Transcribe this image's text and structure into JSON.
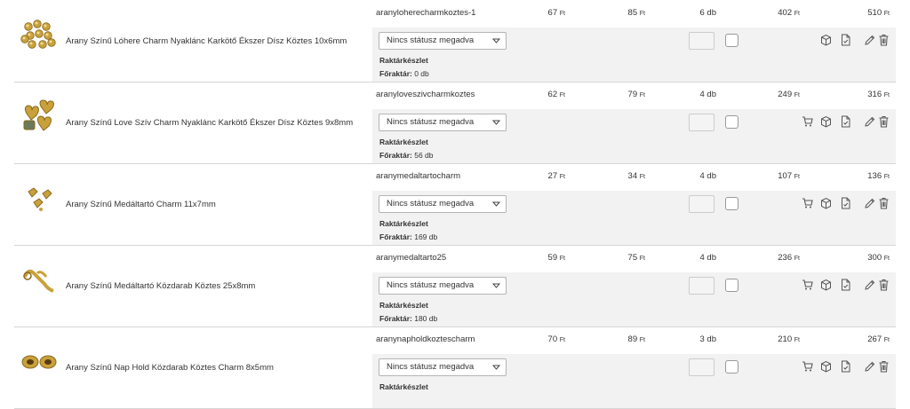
{
  "products": [
    {
      "name": "Arany Színű Lóhere Charm Nyaklánc Karkötő Ékszer Dísz Köztes 10x6mm",
      "sku": "aranyloherecharmkoztes-1",
      "price1": "67",
      "price2": "85",
      "qty": "6 db",
      "total1": "402",
      "total2": "510",
      "currency": "Ft",
      "status": "Nincs státusz megadva",
      "stock_label": "Raktárkészlet",
      "stock_key": "Főraktár:",
      "stock_value": "0 db",
      "has_cart": false,
      "thumb": "clover-charm"
    },
    {
      "name": "Arany Színű Love Szív Charm Nyaklánc Karkötő Ékszer Dísz Köztes 9x8mm",
      "sku": "aranyloveszivcharmkoztes",
      "price1": "62",
      "price2": "79",
      "qty": "4 db",
      "total1": "249",
      "total2": "316",
      "currency": "Ft",
      "status": "Nincs státusz megadva",
      "stock_label": "Raktárkészlet",
      "stock_key": "Főraktár:",
      "stock_value": "56 db",
      "has_cart": true,
      "thumb": "heart-charm"
    },
    {
      "name": "Arany Színű Medáltartó Charm 11x7mm",
      "sku": "aranymedaltartocharm",
      "price1": "27",
      "price2": "34",
      "qty": "4 db",
      "total1": "107",
      "total2": "136",
      "currency": "Ft",
      "status": "Nincs státusz megadva",
      "stock_label": "Raktárkészlet",
      "stock_key": "Főraktár:",
      "stock_value": "169 db",
      "has_cart": true,
      "thumb": "bail-charm"
    },
    {
      "name": "Arany Színű Medáltartó Közdarab Köztes 25x8mm",
      "sku": "aranymedaltarto25",
      "price1": "59",
      "price2": "75",
      "qty": "4 db",
      "total1": "236",
      "total2": "300",
      "currency": "Ft",
      "status": "Nincs státusz megadva",
      "stock_label": "Raktárkészlet",
      "stock_key": "Főraktár:",
      "stock_value": "180 db",
      "has_cart": true,
      "thumb": "bail-connector"
    },
    {
      "name": "Arany Színű Nap Hold Közdarab Köztes Charm 8x5mm",
      "sku": "aranynapholdkoztescharm",
      "price1": "70",
      "price2": "89",
      "qty": "3 db",
      "total1": "210",
      "total2": "267",
      "currency": "Ft",
      "status": "Nincs státusz megadva",
      "stock_label": "Raktárkészlet",
      "stock_key": "",
      "stock_value": "",
      "has_cart": true,
      "thumb": "sun-moon-bead"
    }
  ],
  "icons": {
    "cart": "cart-icon",
    "box": "box-icon",
    "doc": "document-icon",
    "edit": "pencil-icon",
    "del": "trash-icon",
    "chevron": "chevron-down-icon"
  },
  "colors": {
    "row_gray": "#f2f2f2",
    "gold": "#c9a13b",
    "border": "#d6d6d6"
  }
}
